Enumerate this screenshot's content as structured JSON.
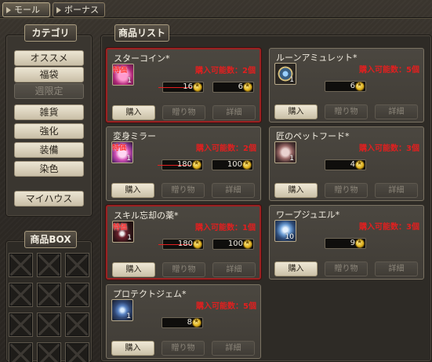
{
  "top_tabs": [
    {
      "label": "モール",
      "active": true
    },
    {
      "label": "ボーナス",
      "active": false
    }
  ],
  "category": {
    "title": "カテゴリ",
    "items": [
      {
        "label": "オススメ",
        "enabled": true
      },
      {
        "label": "福袋",
        "enabled": true
      },
      {
        "label": "週限定",
        "enabled": false
      },
      {
        "label": "雑貨",
        "enabled": true
      },
      {
        "label": "強化",
        "enabled": true
      },
      {
        "label": "装備",
        "enabled": true
      },
      {
        "label": "染色",
        "enabled": true
      },
      {
        "label": "マイハウス",
        "enabled": true
      }
    ]
  },
  "product_box": {
    "title": "商品BOX",
    "slot_count": 12
  },
  "product_list": {
    "title": "商品リスト",
    "buttons": {
      "buy": "購入",
      "gift": "贈り物",
      "detail": "詳細"
    },
    "items": [
      {
        "name": "スターコイン*",
        "limit": "購入可能数：2個",
        "qty": "1",
        "badge": "特価",
        "old_price": "16",
        "price": "6",
        "featured": true,
        "icon": "star-coin-icon"
      },
      {
        "name": "ルーンアミュレット*",
        "limit": "購入可能数：5個",
        "qty": "1",
        "badge": "",
        "old_price": "",
        "price": "6",
        "featured": false,
        "icon": "rune-amulet-icon"
      },
      {
        "name": "変身ミラー",
        "limit": "購入可能数：2個",
        "qty": "1",
        "badge": "特価",
        "old_price": "180",
        "price": "100",
        "featured": false,
        "icon": "transform-mirror-icon"
      },
      {
        "name": "匠のペットフード*",
        "limit": "購入可能数：3個",
        "qty": "1",
        "badge": "",
        "old_price": "",
        "price": "4",
        "featured": false,
        "icon": "pet-food-icon"
      },
      {
        "name": "スキル忘却の薬*",
        "limit": "購入可能数：1個",
        "qty": "1",
        "badge": "特価",
        "old_price": "180",
        "price": "100",
        "featured": true,
        "icon": "skill-potion-icon"
      },
      {
        "name": "ワープジュエル*",
        "limit": "購入可能数：3個",
        "qty": "10",
        "badge": "",
        "old_price": "",
        "price": "9",
        "featured": false,
        "icon": "warp-jewel-icon"
      },
      {
        "name": "プロテクトジェム*",
        "limit": "購入可能数：5個",
        "qty": "1",
        "badge": "",
        "old_price": "",
        "price": "8",
        "featured": false,
        "icon": "protect-gem-icon"
      }
    ]
  },
  "colors": {
    "accent_red": "#e21f1f",
    "featured_border": "#9b2222",
    "coin_gold": "#e2b521"
  }
}
